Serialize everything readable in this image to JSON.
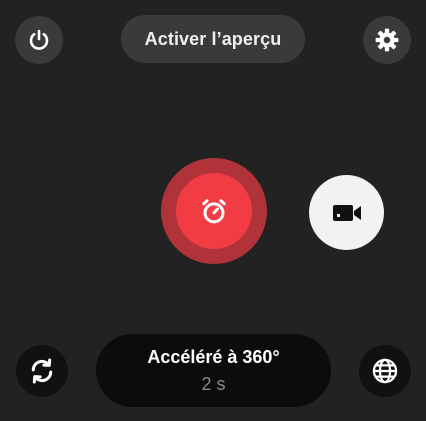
{
  "top_bar": {
    "power_icon": "power-icon",
    "preview_label": "Activer l’aperçu",
    "settings_icon": "gear-icon"
  },
  "capture": {
    "shutter_icon": "timer-icon",
    "shutter_color": "#f03c42",
    "shutter_ring_color": "#b0333a",
    "video_icon": "video-camera-icon"
  },
  "bottom_bar": {
    "sync_icon": "sync-icon",
    "mode_title": "Accéléré à 360°",
    "mode_value": "2 s",
    "globe_icon": "globe-icon"
  }
}
